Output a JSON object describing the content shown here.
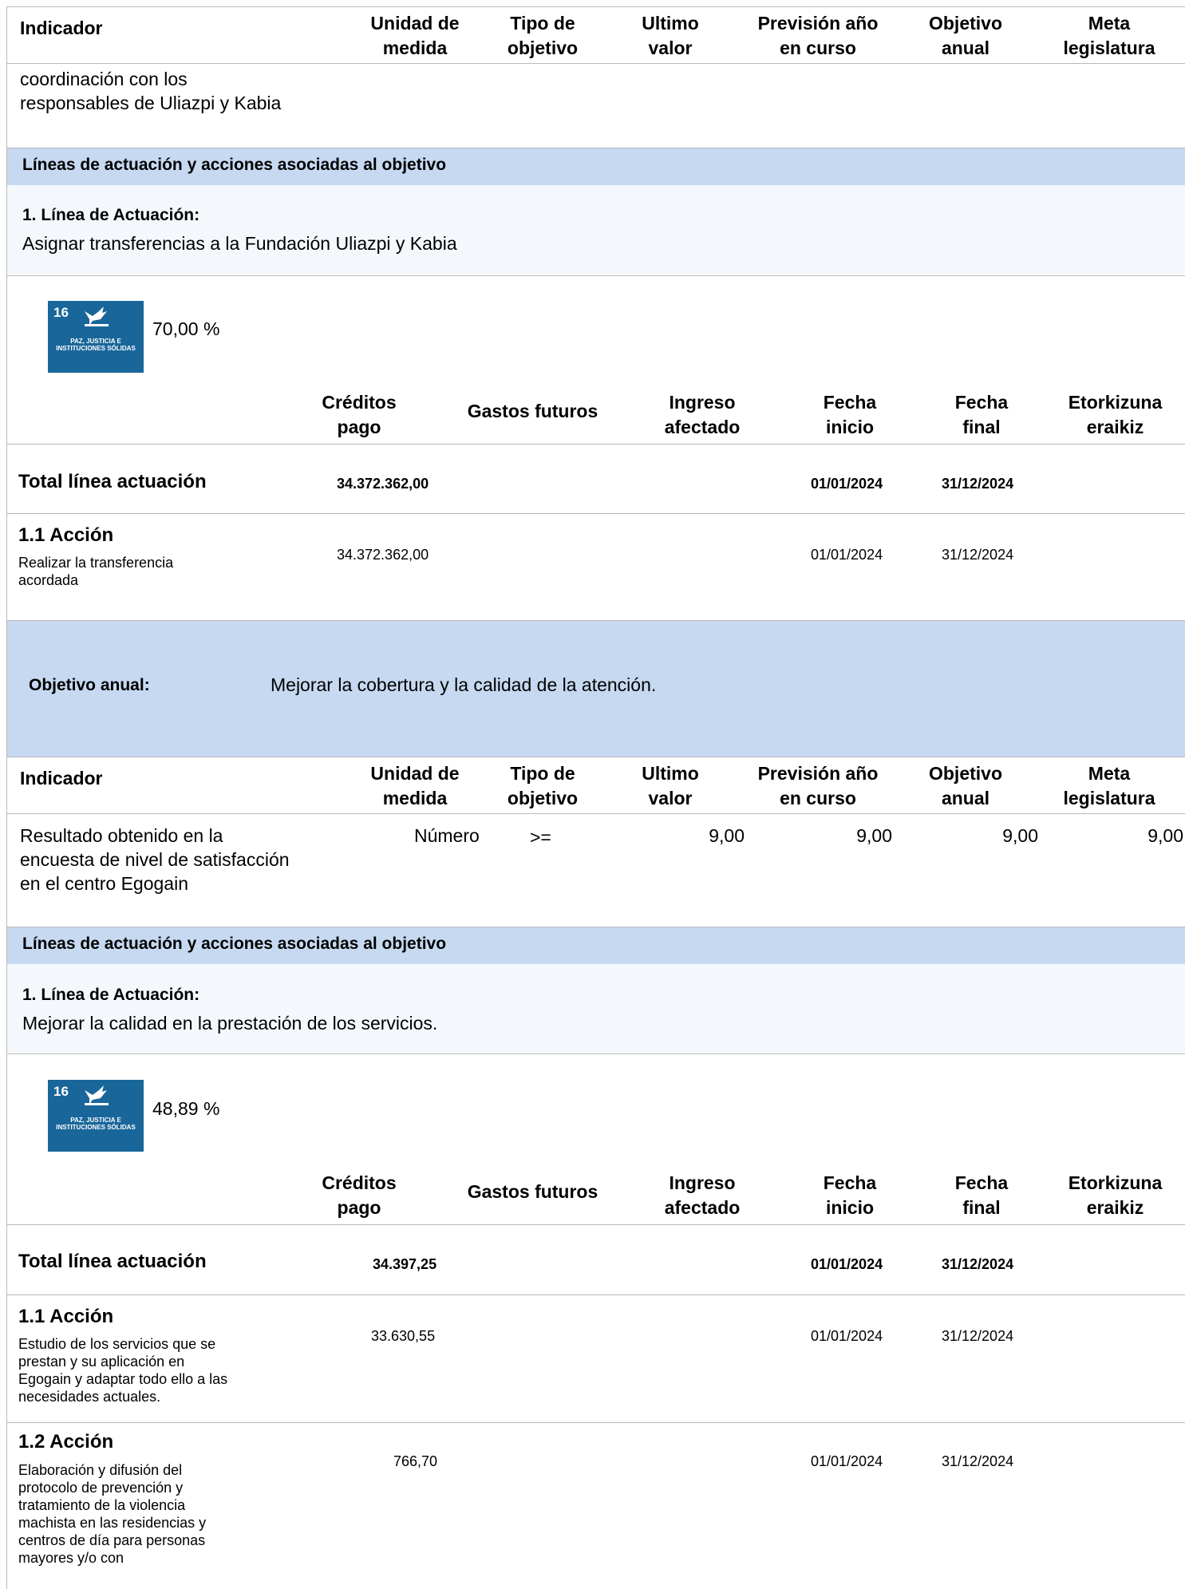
{
  "indicator_header": {
    "indicador": "Indicador",
    "unidad": "Unidad de\nmedida",
    "tipo": "Tipo de\nobjetivo",
    "ultimo": "Ultimo\nvalor",
    "prevision": "Previsión año\nen curso",
    "objetivo": "Objetivo\nanual",
    "meta": "Meta\nlegislatura"
  },
  "top_continuation": "coordinación con los\nresponsables de Uliazpi y Kabia",
  "section1": {
    "lineas_heading": "Líneas de actuación y acciones asociadas al objetivo",
    "linea_title": "1. Línea de Actuación:",
    "linea_desc": "Asignar transferencias a la Fundación Uliazpi y Kabia",
    "sdg": {
      "number": "16",
      "caption": "PAZ, JUSTICIA E INSTITUCIONES SÓLIDAS",
      "percent": "70,00 %",
      "color": "#19669a",
      "icon": "dove-icon"
    },
    "total": {
      "label": "Total línea actuación",
      "creditos": "34.372.362,00",
      "inicio": "01/01/2024",
      "final": "31/12/2024"
    },
    "acciones": [
      {
        "title": "1.1 Acción",
        "desc": "Realizar la transferencia\nacordada",
        "creditos": "34.372.362,00",
        "inicio": "01/01/2024",
        "final": "31/12/2024"
      }
    ]
  },
  "fin_header": {
    "creditos": "Créditos\npago",
    "gastos": "Gastos futuros",
    "ingreso": "Ingreso\nafectado",
    "inicio": "Fecha\ninicio",
    "final": "Fecha\nfinal",
    "etorkizuna": "Etorkizuna\neraikiz"
  },
  "objetivo_anual": {
    "label": "Objetivo anual:",
    "value": "Mejorar la cobertura y la calidad de la atención."
  },
  "indicator_row": {
    "indicador": "Resultado obtenido en la\nencuesta  de nivel de satisfacción\nen el centro Egogain",
    "unidad": "Número",
    "tipo": ">=",
    "ultimo": "9,00",
    "prevision": "9,00",
    "objetivo": "9,00",
    "meta": "9,00"
  },
  "section2": {
    "lineas_heading": "Líneas de actuación y acciones asociadas al objetivo",
    "linea_title": "1. Línea de Actuación:",
    "linea_desc": "Mejorar la calidad en la prestación de los servicios.",
    "sdg": {
      "number": "16",
      "caption": "PAZ, JUSTICIA E INSTITUCIONES SÓLIDAS",
      "percent": "48,89 %",
      "color": "#19669a",
      "icon": "dove-icon"
    },
    "total": {
      "label": "Total línea actuación",
      "creditos": "34.397,25",
      "inicio": "01/01/2024",
      "final": "31/12/2024"
    },
    "acciones": [
      {
        "title": "1.1 Acción",
        "desc": "Estudio de los servicios que se\nprestan y su aplicación en\nEgogain y adaptar todo ello a las\nnecesidades actuales.",
        "creditos": "33.630,55",
        "inicio": "01/01/2024",
        "final": "31/12/2024"
      },
      {
        "title": "1.2 Acción",
        "desc": "Elaboración y difusión del\nprotocolo de prevención y\ntratamiento de la violencia\nmachista en las residencias y\ncentros de día para personas\nmayores y/o con",
        "creditos": "766,70",
        "inicio": "01/01/2024",
        "final": "31/12/2024"
      }
    ]
  }
}
